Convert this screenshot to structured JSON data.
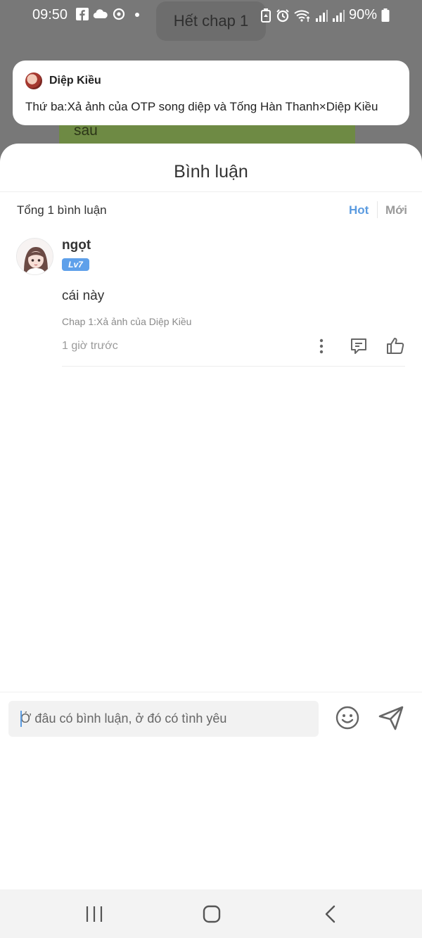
{
  "status_bar": {
    "time": "09:50",
    "battery": "90%",
    "icons": [
      "facebook-icon",
      "cloud-icon",
      "sync-icon",
      "dot-icon",
      "battery-saver-icon",
      "alarm-icon",
      "wifi-icon",
      "signal-icon",
      "signal-icon",
      "battery-icon"
    ]
  },
  "background": {
    "chapter_end_label": "Hết chap 1",
    "partial_text": "sau"
  },
  "notification": {
    "sender": "Diệp Kiều",
    "message": "Thứ ba:Xả ảnh của OTP song diệp và Tống Hàn Thanh×Diệp Kiều"
  },
  "sheet": {
    "title": "Bình luận",
    "total_label": "Tổng 1 bình luận",
    "sort_hot": "Hot",
    "sort_new": "Mới",
    "accent_color": "#5b9be0"
  },
  "comments": [
    {
      "user": "ngọt",
      "level": "Lv7",
      "text": "cái này",
      "chapter": "Chap 1:Xả ảnh của Diệp Kiều",
      "time": "1 giờ trước"
    }
  ],
  "input": {
    "placeholder": "Ở đâu có bình luận, ở đó có tình yêu"
  },
  "nav": {
    "icons": [
      "recents-icon",
      "home-icon",
      "back-icon"
    ]
  }
}
